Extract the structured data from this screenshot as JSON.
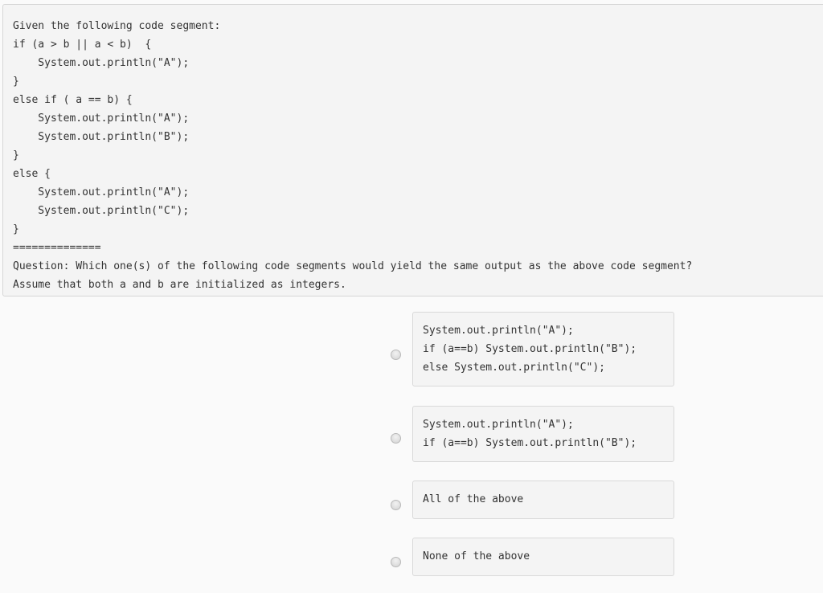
{
  "question": {
    "lines": [
      "Given the following code segment:",
      "if (a > b || a < b)  {",
      "    System.out.println(\"A\");",
      "}",
      "else if ( a == b) {",
      "    System.out.println(\"A\");",
      "    System.out.println(\"B\");",
      "}",
      "else {",
      "    System.out.println(\"A\");",
      "    System.out.println(\"C\");",
      "}",
      "==============",
      "Question: Which one(s) of the following code segments would yield the same output as the above code segment?",
      "Assume that both a and b are initialized as integers."
    ]
  },
  "options": [
    {
      "selected": false,
      "lines": [
        "System.out.println(\"A\");",
        "if (a==b) System.out.println(\"B\");",
        "else System.out.println(\"C\");"
      ]
    },
    {
      "selected": false,
      "lines": [
        "System.out.println(\"A\");",
        "if (a==b) System.out.println(\"B\");"
      ]
    },
    {
      "selected": false,
      "lines": [
        "All of the above"
      ]
    },
    {
      "selected": false,
      "lines": [
        "None of the above"
      ]
    }
  ]
}
